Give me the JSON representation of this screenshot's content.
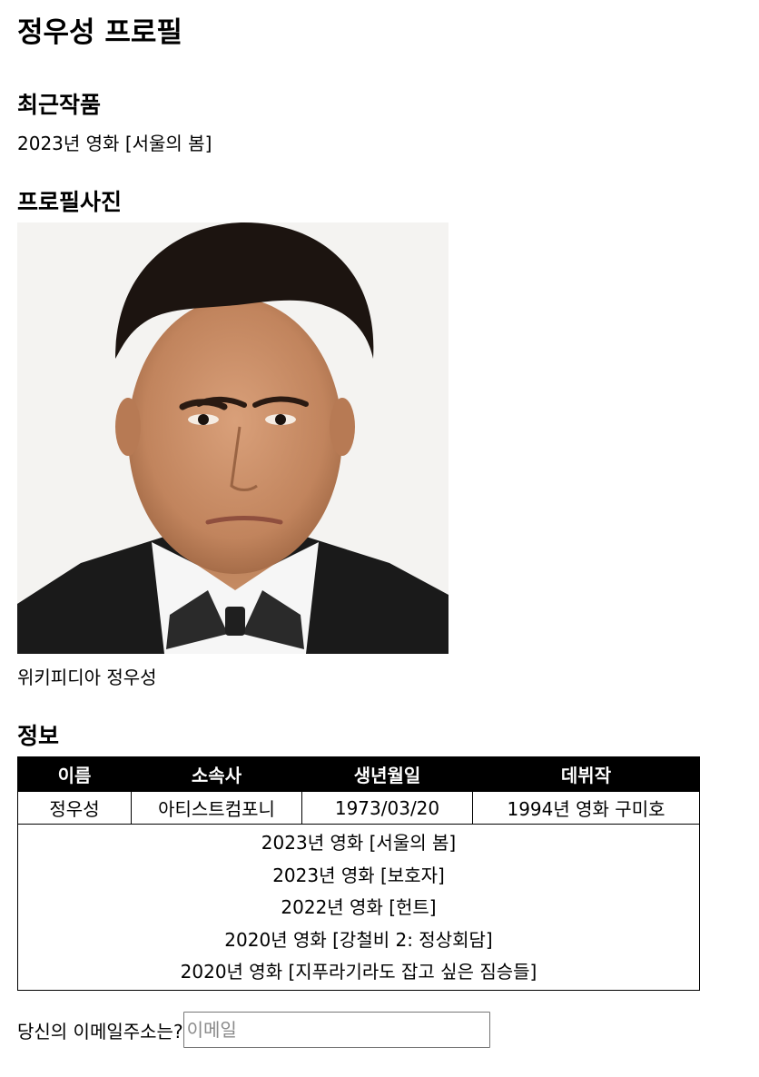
{
  "page": {
    "title": "정우성 프로필"
  },
  "recent": {
    "heading": "최근작품",
    "work": "2023년 영화 [서울의 봄]"
  },
  "photo": {
    "heading": "프로필사진",
    "caption": "위키피디아 정우성"
  },
  "info": {
    "heading": "정보",
    "headers": [
      "이름",
      "소속사",
      "생년월일",
      "데뷔작"
    ],
    "row": [
      "정우성",
      "아티스트컴포니",
      "1973/03/20",
      "1994년 영화 구미호"
    ],
    "works": [
      "2023년 영화 [서울의 봄]",
      "2023년 영화 [보호자]",
      "2022년 영화 [헌트]",
      "2020년 영화 [강철비 2: 정상회담]",
      "2020년 영화 [지푸라기라도 잡고 싶은 짐승들]"
    ]
  },
  "email": {
    "label": "당신의 이메일주소는?",
    "placeholder": "이메일",
    "value": ""
  }
}
